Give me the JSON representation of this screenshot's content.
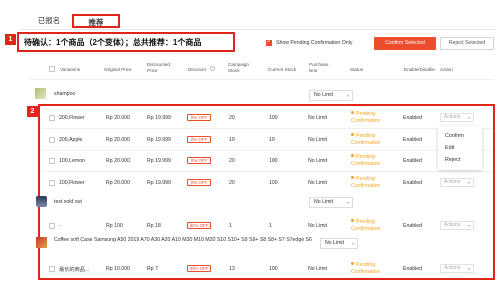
{
  "tabs": [
    {
      "label": "已报名",
      "active": false
    },
    {
      "label": "推荐",
      "active": true
    }
  ],
  "markers": [
    "1",
    "2"
  ],
  "summary": "待确认：1个商品（2个变体）；总共推荐：1个商品",
  "toolbar": {
    "show_pending_label": "Show Pending Confirmation Only",
    "show_pending_checked": true,
    "confirm_selected": "Confirm Selected",
    "reject_selected": "Reject Selected"
  },
  "columns": {
    "variations": "Variations",
    "original_price": "Original Price",
    "discounted_price": "Discounted Price",
    "discount": "Discount",
    "campaign_stock": "Campaign Stock",
    "current_stock": "Current Stock",
    "purchase_limit": "Purchase limit",
    "status": "Status",
    "enable_disable": "Enable/Disable",
    "action": "Action"
  },
  "groups": [
    {
      "name": "shampoo",
      "limit": "No Limit"
    },
    {
      "name": "test sold out",
      "limit": "No Limit"
    },
    {
      "name": "Coffee soft Case Samsung A50 2019 A70 A30 A20 A10 M30 M10 M20 S10 S10+ S9 S9+ S8 S8+ S7 S7edge S6",
      "limit": "No Limit"
    }
  ],
  "rows": [
    {
      "variation": "200,Flower",
      "original": "Rp 20.000",
      "discounted": "Rp 19.999",
      "discount": "0% OFF",
      "campaign_stock": "20",
      "current_stock": "100",
      "limit": "No Limit",
      "status": "Pending Confirmation",
      "enabled": "Enabled",
      "action": "Actions"
    },
    {
      "variation": "200,Apple",
      "original": "Rp 20.000",
      "discounted": "Rp 19.999",
      "discount": "0% OFF",
      "campaign_stock": "19",
      "current_stock": "19",
      "limit": "No Limit",
      "status": "Pending Confirmation",
      "enabled": "Enabled",
      "action": "Actions"
    },
    {
      "variation": "100,Lemon",
      "original": "Rp 20.000",
      "discounted": "Rp 19.999",
      "discount": "0% OFF",
      "campaign_stock": "20",
      "current_stock": "100",
      "limit": "No Limit",
      "status": "Pending Confirmation",
      "enabled": "Enabled",
      "action": "Actions"
    },
    {
      "variation": "100,Flower",
      "original": "Rp 20.000",
      "discounted": "Rp 19.999",
      "discount": "0% OFF",
      "campaign_stock": "20",
      "current_stock": "100",
      "limit": "No Limit",
      "status": "Pending Confirmation",
      "enabled": "Enabled",
      "action": "Actions"
    },
    {
      "variation": "-",
      "original": "Rp 100",
      "discounted": "Rp 18",
      "discount": "82% OFF",
      "campaign_stock": "1",
      "current_stock": "1",
      "limit": "No Limit",
      "status": "Pending Confirmation",
      "enabled": "Enabled",
      "action": "Actions"
    },
    {
      "variation": "最长的商品...",
      "original": "Rp 10.000",
      "discounted": "Rp 7",
      "discount": "33% OFF",
      "campaign_stock": "13",
      "current_stock": "100",
      "limit": "No Limit",
      "status": "Pending Confirmation",
      "enabled": "Enabled",
      "action": "Actions"
    }
  ],
  "action_menu": [
    "Confirm",
    "Edit",
    "Reject"
  ],
  "colors": {
    "accent": "#ee4d2d",
    "highlight": "#e0261b",
    "pending": "#f5a623"
  },
  "icons": [
    "checkbox-icon",
    "chevron-down-icon",
    "product-thumbnail"
  ]
}
